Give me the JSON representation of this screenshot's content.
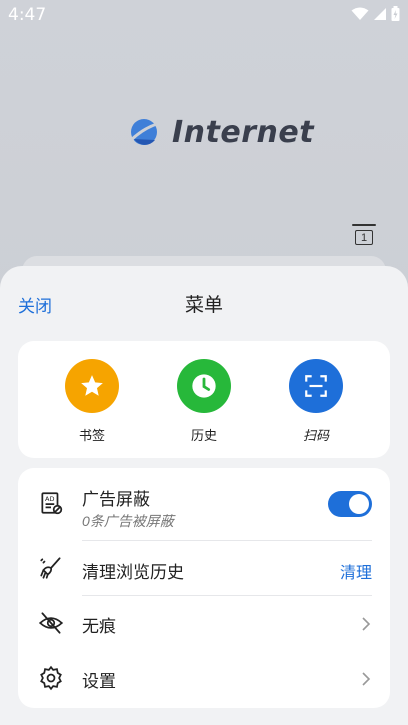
{
  "status": {
    "time": "4:47"
  },
  "browser": {
    "logo_text": "Internet",
    "tab_count": "1"
  },
  "menu": {
    "close_label": "关闭",
    "title": "菜单",
    "quick_actions": [
      {
        "label": "书签",
        "color": "#f6a400",
        "icon": "star-icon"
      },
      {
        "label": "历史",
        "color": "#27b83a",
        "icon": "clock-icon"
      },
      {
        "label": "扫码",
        "color": "#1e6fd9",
        "icon": "scan-icon"
      }
    ],
    "items": {
      "ad_block": {
        "title": "广告屏蔽",
        "subtitle": "0条广告被屏蔽",
        "enabled": true
      },
      "clear_history": {
        "title": "清理浏览历史",
        "action": "清理"
      },
      "incognito": {
        "title": "无痕"
      },
      "settings": {
        "title": "设置"
      }
    }
  },
  "colors": {
    "accent": "#1e6fd9"
  }
}
